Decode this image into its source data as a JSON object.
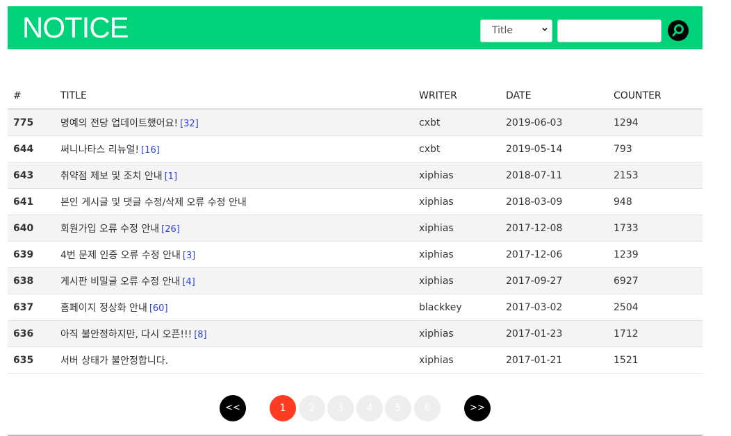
{
  "header": {
    "title": "NOTICE",
    "search": {
      "field_selected": "Title",
      "query": ""
    },
    "colors": {
      "brand": "#00d27a"
    }
  },
  "table": {
    "columns": [
      "#",
      "TITLE",
      "WRITER",
      "DATE",
      "COUNTER"
    ],
    "rows": [
      {
        "num": "775",
        "title": "명예의 전당 업데이트했어요!",
        "comments": "[32]",
        "writer": "cxbt",
        "date": "2019-06-03",
        "counter": "1294"
      },
      {
        "num": "644",
        "title": "써니나타스 리뉴얼!",
        "comments": "[16]",
        "writer": "cxbt",
        "date": "2019-05-14",
        "counter": "793"
      },
      {
        "num": "643",
        "title": "취약점 제보 및 조치 안내",
        "comments": "[1]",
        "writer": "xiphias",
        "date": "2018-07-11",
        "counter": "2153"
      },
      {
        "num": "641",
        "title": "본인 게시글 및 댓글 수정/삭제 오류 수정 안내",
        "comments": "",
        "writer": "xiphias",
        "date": "2018-03-09",
        "counter": "948"
      },
      {
        "num": "640",
        "title": "회원가입 오류 수정 안내",
        "comments": "[26]",
        "writer": "xiphias",
        "date": "2017-12-08",
        "counter": "1733"
      },
      {
        "num": "639",
        "title": "4번 문제 인증 오류 수정 안내",
        "comments": "[3]",
        "writer": "xiphias",
        "date": "2017-12-06",
        "counter": "1239"
      },
      {
        "num": "638",
        "title": "게시판 비밀글 오류 수정 안내",
        "comments": "[4]",
        "writer": "xiphias",
        "date": "2017-09-27",
        "counter": "6927"
      },
      {
        "num": "637",
        "title": "홈페이지 정상화 안내",
        "comments": "[60]",
        "writer": "blackkey",
        "date": "2017-03-02",
        "counter": "2504"
      },
      {
        "num": "636",
        "title": "아직 불안정하지만, 다시 오픈!!!",
        "comments": "[8]",
        "writer": "xiphias",
        "date": "2017-01-23",
        "counter": "1712"
      },
      {
        "num": "635",
        "title": "서버 상태가 불안정합니다.",
        "comments": "",
        "writer": "xiphias",
        "date": "2017-01-21",
        "counter": "1521"
      }
    ]
  },
  "pagination": {
    "first_label": "<<",
    "last_label": ">>",
    "current": "1",
    "pages": [
      "1",
      "2",
      "3",
      "4",
      "5",
      "6"
    ],
    "colors": {
      "active": "#ff3b22",
      "nav": "#000000",
      "inactive": "#eeeeee"
    }
  }
}
